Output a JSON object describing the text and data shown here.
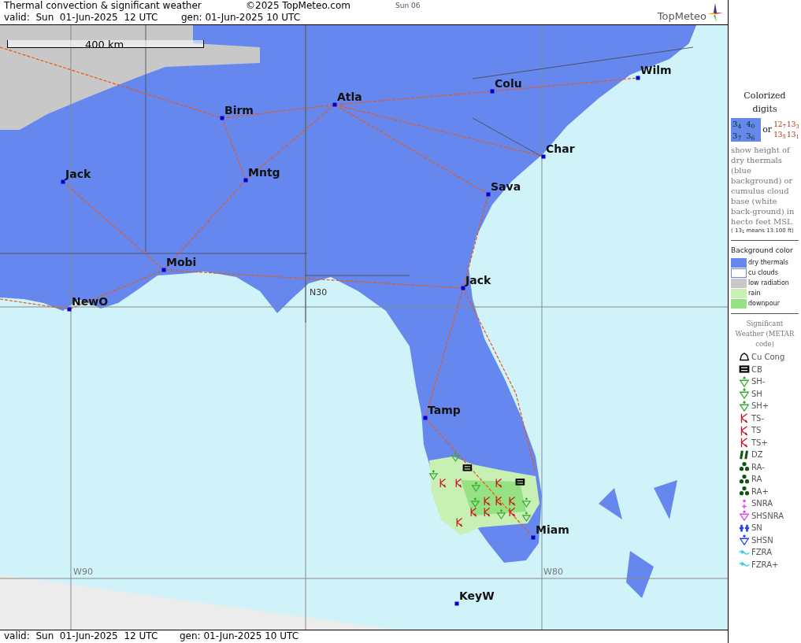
{
  "header": {
    "title": "Thermal convection & significant weather",
    "copyright": "©2025 TopMeteo.com",
    "day": "Sun 06",
    "valid": "valid:  Sun  01-Jun-2025  12 UTC",
    "gen": "gen: 01-Jun-2025 10 UTC",
    "logo": "TopMeteo"
  },
  "map": {
    "scale": "400 km",
    "cities": [
      "Birm",
      "Atla",
      "Colu",
      "Wilm",
      "Char",
      "Jack",
      "Mntg",
      "Sava",
      "Mobi",
      "Jack",
      "NewO",
      "Tamp",
      "Miam",
      "KeyW"
    ],
    "grid_labels": [
      "N30",
      "W90",
      "W80"
    ]
  },
  "footer": {
    "valid": "valid:  Sun  01-Jun-2025  12 UTC",
    "gen": "gen: 01-Jun-2025 10 UTC"
  },
  "legend": {
    "digits_title": "Colorized digits",
    "blue_digits": [
      "3$_{4}$",
      "4$_{0}$",
      "3$_{7}$",
      "3$_{6}$"
    ],
    "or": "or",
    "white_digits": [
      "12$_{7}$",
      "13$_{3}$",
      "13$_{5}$",
      "13$_{1}$"
    ],
    "description": "show height of dry thermals (blue background) or cumulus cloud base (white back-ground) in hecto feet MSL",
    "example": "( 13$_{1}$ means 13.100 ft)",
    "background_title": "Background color",
    "backgrounds": [
      {
        "label": "dry thermals",
        "color": "#6688ee"
      },
      {
        "label": "cu clouds",
        "color": "#ffffff"
      },
      {
        "label": "low radiation",
        "color": "#c8c8c8"
      },
      {
        "label": "rain",
        "color": "#c8f0b4"
      },
      {
        "label": "downpour",
        "color": "#96e182"
      }
    ],
    "sigwx_title": "Significant Weather (METAR code)",
    "sigwx": [
      {
        "label": "Cu Cong",
        "kind": "cucong",
        "color": "#000000"
      },
      {
        "label": "CB",
        "kind": "cb",
        "color": "#000000"
      },
      {
        "label": "SH-",
        "kind": "shower",
        "color": "#33aa33"
      },
      {
        "label": "SH",
        "kind": "shower",
        "color": "#33aa33"
      },
      {
        "label": "SH+",
        "kind": "shower",
        "color": "#33aa33"
      },
      {
        "label": "TS-",
        "kind": "ts",
        "color": "#cc1122"
      },
      {
        "label": "TS",
        "kind": "ts",
        "color": "#cc1122"
      },
      {
        "label": "TS+",
        "kind": "ts",
        "color": "#cc1122"
      },
      {
        "label": "DZ",
        "kind": "dz",
        "color": "#115511"
      },
      {
        "label": "RA-",
        "kind": "ra",
        "color": "#115511"
      },
      {
        "label": "RA",
        "kind": "ra",
        "color": "#115511"
      },
      {
        "label": "RA+",
        "kind": "ra",
        "color": "#115511"
      },
      {
        "label": "SNRA",
        "kind": "snra",
        "color": "#dd44ee"
      },
      {
        "label": "SHSNRA",
        "kind": "shower",
        "color": "#dd44ee"
      },
      {
        "label": "SN",
        "kind": "sn",
        "color": "#2244ee"
      },
      {
        "label": "SHSN",
        "kind": "shower",
        "color": "#2244ee"
      },
      {
        "label": "FZRA",
        "kind": "fzra",
        "color": "#22ccee"
      },
      {
        "label": "FZRA+",
        "kind": "fzra",
        "color": "#22ccee"
      }
    ]
  }
}
